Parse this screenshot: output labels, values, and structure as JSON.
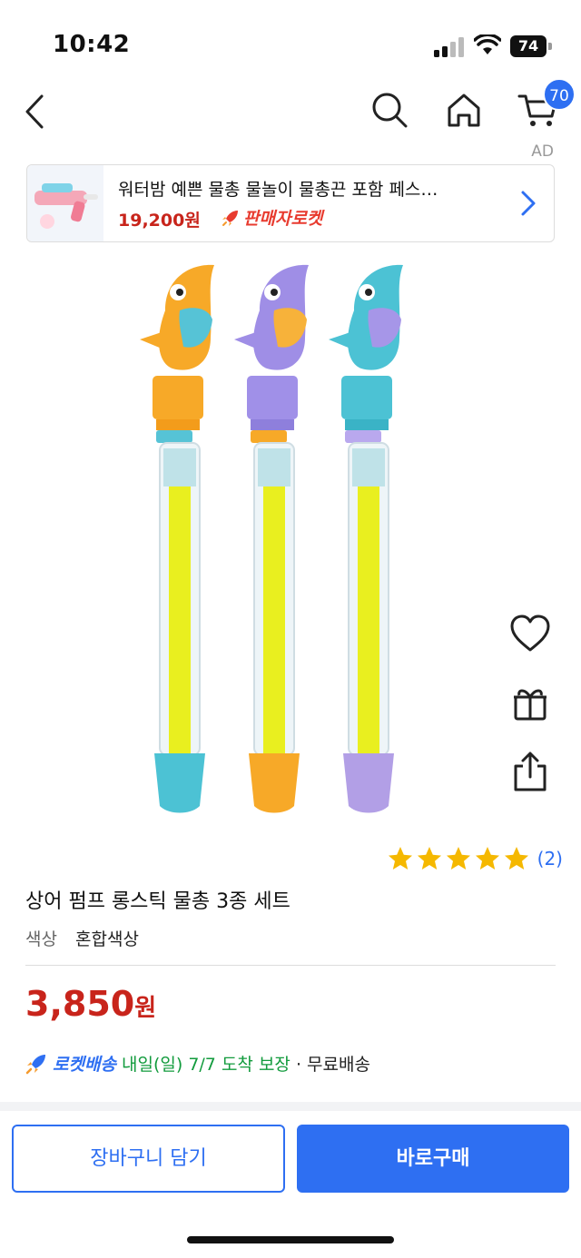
{
  "status_bar": {
    "time": "10:42",
    "battery": "74"
  },
  "nav": {
    "cart_count": "70",
    "ad_label": "AD"
  },
  "ad_banner": {
    "title": "워터밤 예쁜 물총 물놀이 물총끈 포함 페스…",
    "price": "19,200원",
    "badge": "판매자로켓"
  },
  "product": {
    "rating_count": "(2)",
    "title": "상어 펌프 롱스틱 물총 3종 세트",
    "option_label": "색상",
    "option_value": "혼합색상",
    "price_amount": "3,850",
    "price_unit": "원",
    "rating_stars": 5
  },
  "delivery": {
    "rocket_label": "로켓배송",
    "date_text": "내일(일) 7/7 도착 보장",
    "separator": " · ",
    "free_text": "무료배송"
  },
  "actions": {
    "cart_button": "장바구니 담기",
    "buy_button": "바로구매"
  },
  "colors": {
    "accent_blue": "#2e6ff2",
    "price_red": "#c8241b",
    "delivery_green": "#129b3d",
    "star_yellow": "#f5b800"
  }
}
